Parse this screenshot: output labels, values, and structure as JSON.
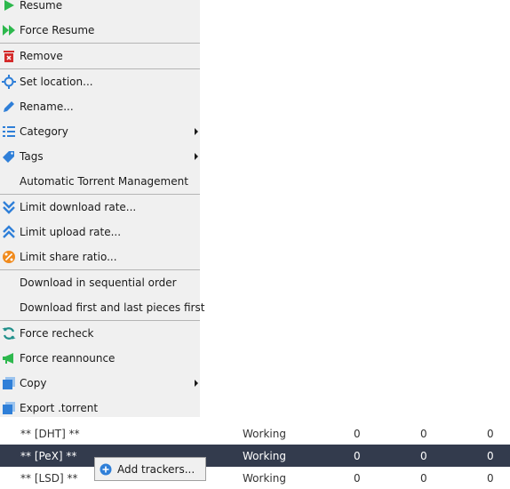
{
  "menu": {
    "items": [
      {
        "label": "Resume",
        "icon": "play-icon"
      },
      {
        "label": "Force Resume",
        "icon": "fast-forward-icon"
      },
      {
        "label": "Remove",
        "icon": "trash-icon"
      },
      {
        "label": "Set location...",
        "icon": "crosshair-icon"
      },
      {
        "label": "Rename...",
        "icon": "pencil-icon"
      },
      {
        "label": "Category",
        "icon": "list-icon",
        "submenu": true
      },
      {
        "label": "Tags",
        "icon": "tag-icon",
        "submenu": true
      },
      {
        "label": "Automatic Torrent Management",
        "icon": ""
      },
      {
        "label": "Limit download rate...",
        "icon": "double-chevron-down-icon"
      },
      {
        "label": "Limit upload rate...",
        "icon": "double-chevron-up-icon"
      },
      {
        "label": "Limit share ratio...",
        "icon": "ratio-icon"
      },
      {
        "label": "Download in sequential order",
        "icon": ""
      },
      {
        "label": "Download first and last pieces first",
        "icon": ""
      },
      {
        "label": "Force recheck",
        "icon": "refresh-icon"
      },
      {
        "label": "Force reannounce",
        "icon": "megaphone-icon"
      },
      {
        "label": "Copy",
        "icon": "copy-icon",
        "submenu": true
      },
      {
        "label": "Export .torrent",
        "icon": "export-icon"
      }
    ]
  },
  "trackers": {
    "rows": [
      {
        "name": "** [DHT] **",
        "status": "Working",
        "c1": "0",
        "c2": "0",
        "c3": "0",
        "selected": false
      },
      {
        "name": "** [PeX] **",
        "status": "Working",
        "c1": "0",
        "c2": "0",
        "c3": "0",
        "selected": true
      },
      {
        "name": "** [LSD] **",
        "status": "Working",
        "c1": "0",
        "c2": "0",
        "c3": "0",
        "selected": false
      }
    ]
  },
  "popup": {
    "label": "Add trackers...",
    "icon": "add-circle-icon"
  },
  "colors": {
    "menu_bg": "#f0f0f0",
    "selected_row": "#333b4d",
    "green": "#2db84d",
    "red": "#d42a2a",
    "blue": "#2f7fd8",
    "orange": "#f08a1c",
    "teal": "#1f8f8a"
  }
}
